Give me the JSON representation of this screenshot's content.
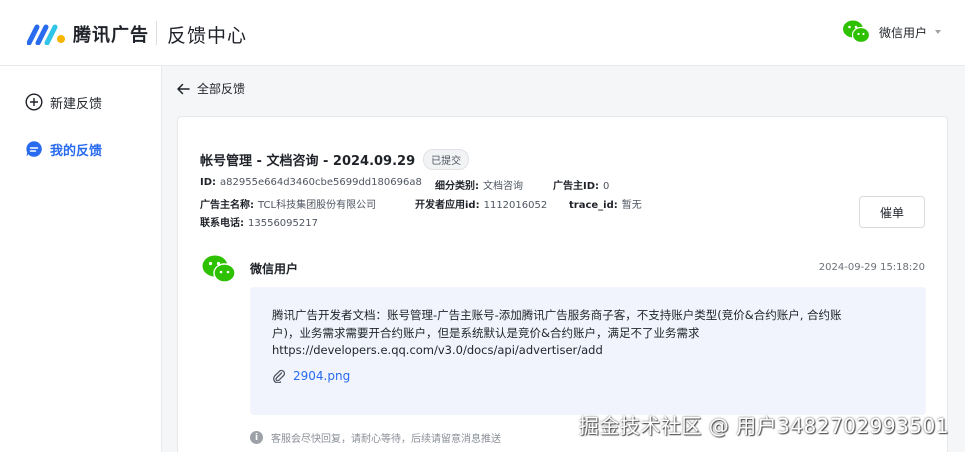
{
  "header": {
    "brand": "腾讯广告",
    "section": "反馈中心",
    "user": "微信用户"
  },
  "sidebar": {
    "items": [
      {
        "label": "新建反馈",
        "icon": "plus-circle-icon",
        "active": false
      },
      {
        "label": "我的反馈",
        "icon": "chat-bubble-icon",
        "active": true
      }
    ]
  },
  "nav": {
    "back_label": "全部反馈"
  },
  "ticket": {
    "title": "帐号管理 - 文档咨询 - 2024.09.29",
    "status": "已提交",
    "fields": {
      "id": {
        "label": "ID:",
        "value": "a82955e664d3460cbe5699dd180696a8"
      },
      "category": {
        "label": "细分类别:",
        "value": "文档咨询"
      },
      "advertiser_id": {
        "label": "广告主ID:",
        "value": "0"
      },
      "advertiser_name": {
        "label": "广告主名称:",
        "value": "TCL科技集团股份有限公司"
      },
      "dev_app_id": {
        "label": "开发者应用id:",
        "value": "1112016052"
      },
      "trace_id": {
        "label": "trace_id:",
        "value": "暂无"
      },
      "phone": {
        "label": "联系电话:",
        "value": "13556095217"
      }
    },
    "urge_button": "催单"
  },
  "message": {
    "user": "微信用户",
    "time": "2024-09-29 15:18:20",
    "lines": [
      "腾讯广告开发者文档：账号管理-广告主账号-添加腾讯广告服务商子客，不支持账户类型(竞价&合约账户, 合约账",
      "户)，业务需求需要开合约账户，但是系统默认是竞价&合约账户，满足不了业务需求",
      "https://developers.e.qq.com/v3.0/docs/api/advertiser/add"
    ],
    "attachment": "2904.png"
  },
  "notice": "客服会尽快回复，请耐心等待，后续请留意消息推送",
  "watermark": "掘金技术社区 @ 用户3482702993501",
  "colors": {
    "accent": "#296bef",
    "wechat_green": "#2dc100",
    "bubble_bg": "#f1f4fd"
  }
}
